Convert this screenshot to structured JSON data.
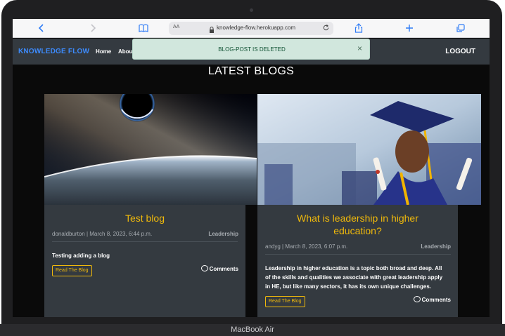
{
  "device": {
    "label": "MacBook Air"
  },
  "browser": {
    "text_size_label": "AA",
    "url": "knowledge-flow.herokuapp.com",
    "icons": [
      "chevron-left-icon",
      "chevron-right-icon",
      "book-icon",
      "lock-icon",
      "reload-icon",
      "share-icon",
      "plus-icon",
      "tabs-icon"
    ]
  },
  "navbar": {
    "brand": "KNOWLEDGE FLOW",
    "links": [
      "Home",
      "Abou"
    ],
    "logout": "LOGOUT"
  },
  "alert": {
    "message": "BLOG-POST IS DELETED",
    "close": "×"
  },
  "page": {
    "title": "LATEST BLOGS"
  },
  "cards": [
    {
      "title": "Test blog",
      "author": "donaldburton",
      "date": "March 8, 2023, 6:44 p.m.",
      "category": "Leadership",
      "excerpt": "Testing adding a blog",
      "button": "Read The Blog",
      "comments": "Comments"
    },
    {
      "title_line1": "What is leadership in higher",
      "title_line2": "education?",
      "author": "andyg",
      "date": "March 8, 2023, 6:07 p.m.",
      "category": "Leadership",
      "excerpt_line1": "Leadership in higher education is a topic both broad and deep. All",
      "excerpt_line2": "of the skills and qualities we associate with great leadership apply",
      "excerpt_line3": "in HE, but like many sectors, it has its own unique challenges.",
      "button": "Read The Blog",
      "comments": "Comments"
    }
  ],
  "colors": {
    "navbar": "#343a40",
    "brand": "#3d8bfd",
    "accent": "#f0b90b",
    "alert_bg": "#d1e7dd",
    "card_bg": "#343a40"
  }
}
